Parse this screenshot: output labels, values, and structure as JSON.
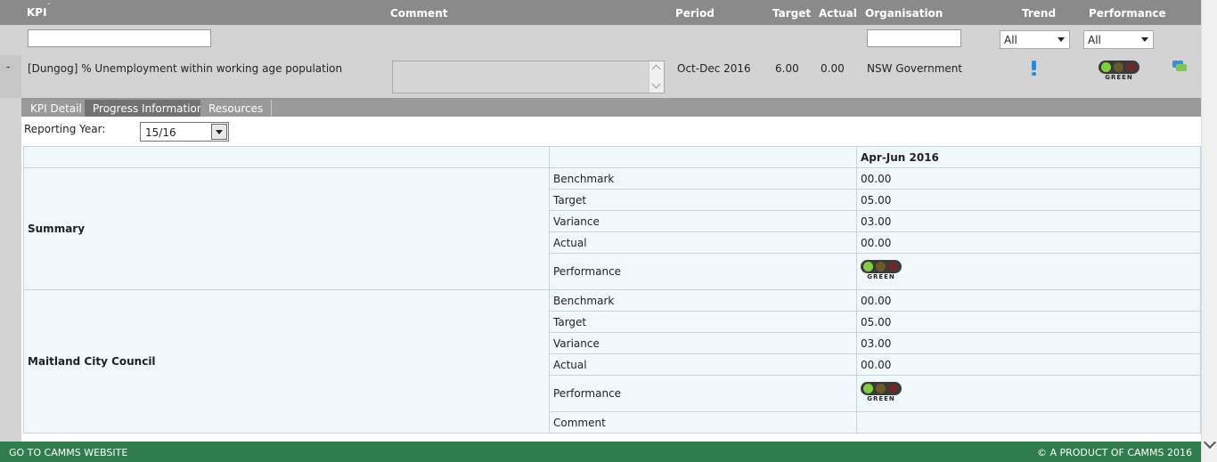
{
  "header": {
    "kpi": "KPI",
    "comment": "Comment",
    "period": "Period",
    "target": "Target",
    "actual": "Actual",
    "organisation": "Organisation",
    "trend": "Trend",
    "performance": "Performance"
  },
  "filters": {
    "trend_value": "All",
    "performance_value": "All"
  },
  "kpi_row": {
    "toggle": "-",
    "name": "[Dungog] % Unemployment within working age population",
    "comment": "",
    "period": "Oct-Dec 2016",
    "target": "6.00",
    "actual": "0.00",
    "organisation": "NSW Government",
    "trend_icon": "exclamation-icon",
    "performance_icon": "traffic-light-green-icon",
    "performance_label": "GREEN",
    "chat_icon": "comments-icon"
  },
  "tabs": [
    {
      "label": "KPI Detail",
      "active": false
    },
    {
      "label": "Progress Information",
      "active": true
    },
    {
      "label": "Resources",
      "active": false
    }
  ],
  "reporting_year": {
    "label": "Reporting Year:",
    "value": "15/16"
  },
  "progress_table": {
    "period_header": "Apr-Jun 2016",
    "groups": [
      {
        "name": "Summary",
        "rows": [
          {
            "label": "Benchmark",
            "value": "00.00"
          },
          {
            "label": "Target",
            "value": "05.00"
          },
          {
            "label": "Variance",
            "value": "03.00"
          },
          {
            "label": "Actual",
            "value": "00.00"
          },
          {
            "label": "Performance",
            "value": "GREEN"
          }
        ]
      },
      {
        "name": "Maitland City Council",
        "rows": [
          {
            "label": "Benchmark",
            "value": "00.00"
          },
          {
            "label": "Target",
            "value": "05.00"
          },
          {
            "label": "Variance",
            "value": "03.00"
          },
          {
            "label": "Actual",
            "value": "00.00"
          },
          {
            "label": "Performance",
            "value": "GREEN"
          },
          {
            "label": "Comment",
            "value": ""
          }
        ]
      }
    ]
  },
  "footer": {
    "link": "GO TO CAMMS WEBSITE",
    "copyright": "© A PRODUCT OF CAMMS 2016"
  },
  "colors": {
    "header_bg": "#8a8a8a",
    "footer_bg": "#2e7d4b",
    "table_cell_bg": "#f1f8fb",
    "performance_green": "#7fd23a",
    "trend_blue": "#1e8fe0"
  }
}
